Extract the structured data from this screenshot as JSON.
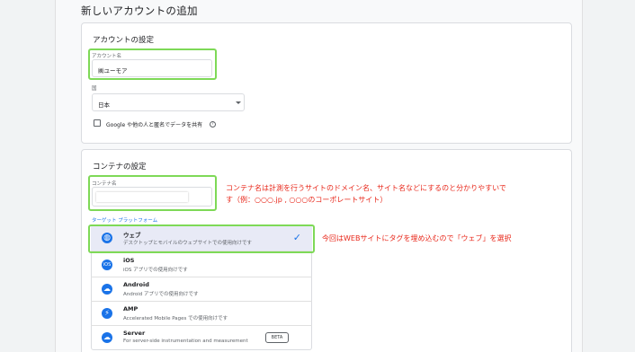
{
  "page": {
    "title": "新しいアカウントの追加"
  },
  "account_settings": {
    "title": "アカウントの設定",
    "account_name_label": "アカウント名",
    "account_name_value": "㈱ユーモア",
    "country_label": "国",
    "country_value": "日本",
    "share_label": "Google や他の人と匿名でデータを共有",
    "help_glyph": "?"
  },
  "container_settings": {
    "title": "コンテナの設定",
    "container_name_label": "コンテナ名",
    "container_name_value": "",
    "target_platform_label": "ターゲット プラットフォーム",
    "annotation_1_line1": "コンテナ名は計測を行うサイトのドメイン名、サイト名などにするのと分かりやすいで",
    "annotation_1_line2": "す（例：○○○.jp , ○○○のコーポレートサイト）",
    "annotation_2": "今回はWEBサイトにタグを埋め込むので「ウェブ」を選択",
    "platforms": [
      {
        "name": "ウェブ",
        "desc": "デスクトップとモバイルのウェブサイトでの使用向けです",
        "icon": "globe-icon",
        "glyph": "◍",
        "selected": true
      },
      {
        "name": "iOS",
        "desc": "iOS アプリでの使用向けです",
        "icon": "ios-icon",
        "glyph": "iOS",
        "selected": false
      },
      {
        "name": "Android",
        "desc": "Android アプリでの使用向けです",
        "icon": "cloud-icon",
        "glyph": "☁",
        "selected": false
      },
      {
        "name": "AMP",
        "desc": "Accelerated Mobile Pages での使用向けです",
        "icon": "lightning-icon",
        "glyph": "⚡",
        "selected": false
      },
      {
        "name": "Server",
        "desc": "For server-side instrumentation and measurement",
        "icon": "cloud-icon",
        "glyph": "☁",
        "selected": false,
        "badge": "BETA"
      }
    ],
    "checkmark_glyph": "✓"
  },
  "colors": {
    "accent_blue": "#1a73e8",
    "highlight_green": "#7ed957",
    "annotation_red": "#e8281b",
    "selected_bg": "#e8eaf6"
  }
}
